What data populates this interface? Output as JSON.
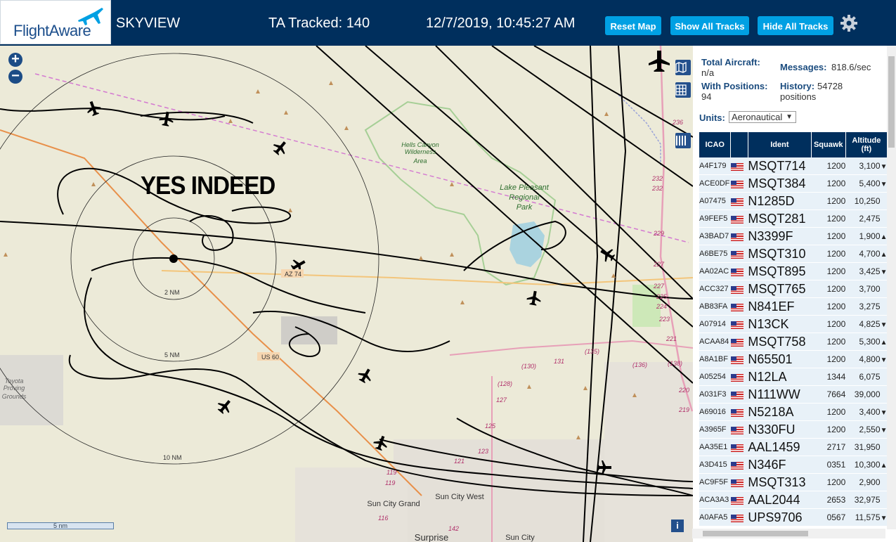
{
  "header": {
    "logo": "FlightAware",
    "app_title": "SKYVIEW",
    "ta_tracked": "TA Tracked: 140",
    "datetime": "12/7/2019, 10:45:27 AM",
    "buttons": {
      "reset": "Reset Map",
      "show": "Show All Tracks",
      "hide": "Hide All Tracks"
    }
  },
  "map": {
    "zoom_in": "+",
    "zoom_out": "−",
    "overlay_label": "YES INDEED",
    "scale": "5 nm",
    "info": "i",
    "labels": {
      "hells_canyon": "Hells Canyon Wilderness Area",
      "hells_canyon_lines": [
        "Hells Canyon",
        "Wilderness",
        "Area"
      ],
      "lake_pleasant_lines": [
        "Lake Pleasant",
        "Regional",
        "Park"
      ],
      "toyota_lines": [
        "Toyota",
        "Proving",
        "Grounds"
      ],
      "sun_city_grand": "Sun City Grand",
      "sun_city_west": "Sun City West",
      "sun_city": "Sun City",
      "surprise": "Surprise",
      "az74": "AZ 74",
      "us60": "US 60",
      "ring_2nm": "2 NM",
      "ring_5nm": "5 NM",
      "ring_10nm": "10 NM",
      "route_numbers": [
        "236",
        "232",
        "232",
        "229",
        "227",
        "227",
        "225",
        "224",
        "223",
        "221",
        "(135)",
        "(136)",
        "(130)",
        "131",
        "(128)",
        "127",
        "125",
        "123",
        "121",
        "119",
        "119",
        "116",
        "142",
        "(138)",
        "220",
        "219"
      ]
    }
  },
  "panel": {
    "total_aircraft_label": "Total Aircraft:",
    "total_aircraft_value": "n/a",
    "with_positions_label": "With Positions:",
    "with_positions_value": "94",
    "messages_label": "Messages:",
    "messages_value": "818.6/sec",
    "history_label": "History:",
    "history_value": "54728",
    "history_unit": "positions",
    "units_label": "Units:",
    "units_value": "Aeronautical",
    "columns": [
      "ICAO",
      "",
      "Ident",
      "Squawk",
      "Altitude (ft)"
    ],
    "rows": [
      {
        "icao": "A4F179",
        "ident": "MSQT714",
        "squawk": "1200",
        "alt": "3,100",
        "trend": "▼"
      },
      {
        "icao": "ACE0DF",
        "ident": "MSQT384",
        "squawk": "1200",
        "alt": "5,400",
        "trend": "▼"
      },
      {
        "icao": "A07475",
        "ident": "N1285D",
        "squawk": "1200",
        "alt": "10,250",
        "trend": ""
      },
      {
        "icao": "A9FEF5",
        "ident": "MSQT281",
        "squawk": "1200",
        "alt": "2,475",
        "trend": ""
      },
      {
        "icao": "A3BAD7",
        "ident": "N3399F",
        "squawk": "1200",
        "alt": "1,900",
        "trend": "▲"
      },
      {
        "icao": "A6BE75",
        "ident": "MSQT310",
        "squawk": "1200",
        "alt": "4,700",
        "trend": "▲"
      },
      {
        "icao": "AA02AC",
        "ident": "MSQT895",
        "squawk": "1200",
        "alt": "3,425",
        "trend": "▼"
      },
      {
        "icao": "ACC327",
        "ident": "MSQT765",
        "squawk": "1200",
        "alt": "3,700",
        "trend": ""
      },
      {
        "icao": "AB83FA",
        "ident": "N841EF",
        "squawk": "1200",
        "alt": "3,275",
        "trend": ""
      },
      {
        "icao": "A07914",
        "ident": "N13CK",
        "squawk": "1200",
        "alt": "4,825",
        "trend": "▼"
      },
      {
        "icao": "ACAA84",
        "ident": "MSQT758",
        "squawk": "1200",
        "alt": "5,300",
        "trend": "▲"
      },
      {
        "icao": "A8A1BF",
        "ident": "N65501",
        "squawk": "1200",
        "alt": "4,800",
        "trend": "▼"
      },
      {
        "icao": "A05254",
        "ident": "N12LA",
        "squawk": "1344",
        "alt": "6,075",
        "trend": ""
      },
      {
        "icao": "A031F3",
        "ident": "N111WW",
        "squawk": "7664",
        "alt": "39,000",
        "trend": ""
      },
      {
        "icao": "A69016",
        "ident": "N5218A",
        "squawk": "1200",
        "alt": "3,400",
        "trend": "▼"
      },
      {
        "icao": "A3965F",
        "ident": "N330FU",
        "squawk": "1200",
        "alt": "2,550",
        "trend": "▼"
      },
      {
        "icao": "AA35E1",
        "ident": "AAL1459",
        "squawk": "2717",
        "alt": "31,950",
        "trend": ""
      },
      {
        "icao": "A3D415",
        "ident": "N346F",
        "squawk": "0351",
        "alt": "10,300",
        "trend": "▲"
      },
      {
        "icao": "AC9F5F",
        "ident": "MSQT313",
        "squawk": "1200",
        "alt": "2,900",
        "trend": ""
      },
      {
        "icao": "ACA3A3",
        "ident": "AAL2044",
        "squawk": "2653",
        "alt": "32,975",
        "trend": ""
      },
      {
        "icao": "A0AFA5",
        "ident": "UPS9706",
        "squawk": "0567",
        "alt": "11,575",
        "trend": "▼"
      }
    ]
  }
}
